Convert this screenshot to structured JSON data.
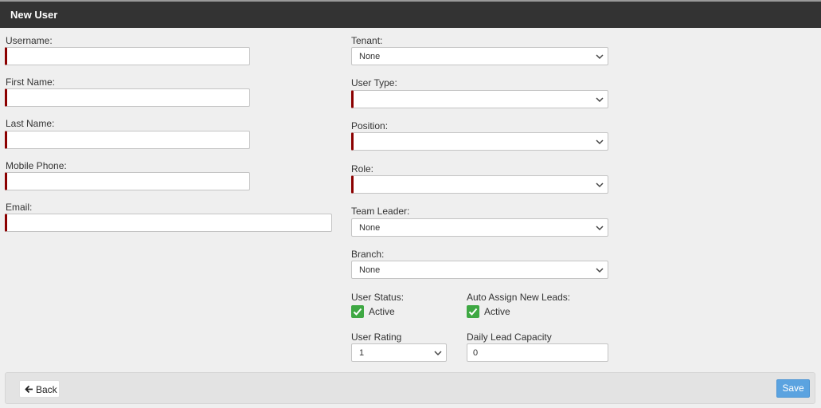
{
  "header": {
    "title": "New User"
  },
  "left": {
    "username_label": "Username:",
    "first_name_label": "First Name:",
    "last_name_label": "Last Name:",
    "mobile_label": "Mobile Phone:",
    "email_label": "Email:"
  },
  "right": {
    "tenant_label": "Tenant:",
    "tenant_value": "None",
    "user_type_label": "User Type:",
    "position_label": "Position:",
    "role_label": "Role:",
    "team_leader_label": "Team Leader:",
    "team_leader_value": "None",
    "branch_label": "Branch:",
    "branch_value": "None",
    "user_status_label": "User Status:",
    "user_status_check": "Active",
    "auto_assign_label": "Auto Assign New Leads:",
    "auto_assign_check": "Active",
    "user_rating_label": "User Rating",
    "user_rating_value": "1",
    "daily_capacity_label": "Daily Lead Capacity",
    "daily_capacity_value": "0"
  },
  "footer": {
    "back_label": "Back",
    "save_label": "Save"
  },
  "colors": {
    "header_bg": "#333333",
    "required_marker": "#8b0000",
    "check_green": "#3ea843",
    "save_blue": "#5ba3e0"
  }
}
